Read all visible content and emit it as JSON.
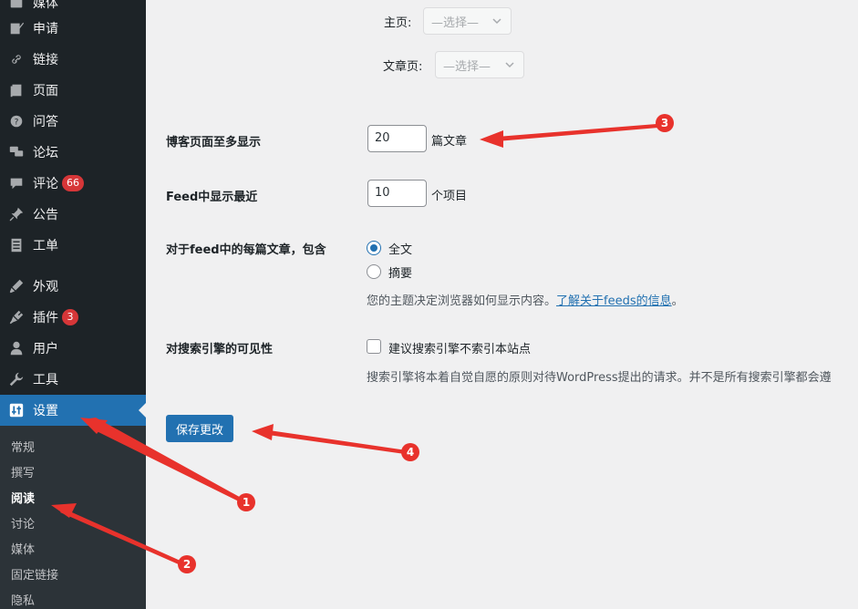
{
  "sidebar": {
    "items": [
      {
        "label": "媒体",
        "icon": "media-icon"
      },
      {
        "label": "申请",
        "icon": "edit-icon"
      },
      {
        "label": "链接",
        "icon": "link-icon"
      },
      {
        "label": "页面",
        "icon": "page-icon"
      },
      {
        "label": "问答",
        "icon": "question-icon"
      },
      {
        "label": "论坛",
        "icon": "forum-icon"
      },
      {
        "label": "评论",
        "icon": "comment-icon",
        "badge": "66"
      },
      {
        "label": "公告",
        "icon": "pin-icon"
      },
      {
        "label": "工单",
        "icon": "ticket-icon"
      },
      {
        "label": "外观",
        "icon": "appearance-icon"
      },
      {
        "label": "插件",
        "icon": "plugin-icon",
        "badge": "3"
      },
      {
        "label": "用户",
        "icon": "user-icon"
      },
      {
        "label": "工具",
        "icon": "wrench-icon"
      },
      {
        "label": "设置",
        "icon": "settings-icon"
      }
    ],
    "submenu": [
      "常规",
      "撰写",
      "阅读",
      "讨论",
      "媒体",
      "固定链接",
      "隐私"
    ]
  },
  "form": {
    "homepage_label": "主页:",
    "postspage_label": "文章页:",
    "select_placeholder": "—选择—",
    "posts_per_page_label": "博客页面至多显示",
    "posts_per_page_value": "20",
    "posts_per_page_suffix": "篇文章",
    "feed_count_label": "Feed中显示最近",
    "feed_count_value": "10",
    "feed_count_suffix": "个项目",
    "feed_content_label": "对于feed中的每篇文章，包含",
    "feed_full_text": "全文",
    "feed_summary": "摘要",
    "feed_desc": "您的主题决定浏览器如何显示内容。",
    "feed_desc_link": "了解关于feeds的信息",
    "feed_desc_end": "。",
    "search_visibility_label": "对搜索引擎的可见性",
    "search_visibility_checkbox": "建议搜索引擎不索引本站点",
    "search_visibility_desc": "搜索引擎将本着自觉自愿的原则对待WordPress提出的请求。并不是所有搜索引擎都会遵",
    "save_button": "保存更改"
  },
  "annotations": {
    "marker_1": "1",
    "marker_2": "2",
    "marker_3": "3",
    "marker_4": "4",
    "arrow_color": "#e8322c"
  }
}
